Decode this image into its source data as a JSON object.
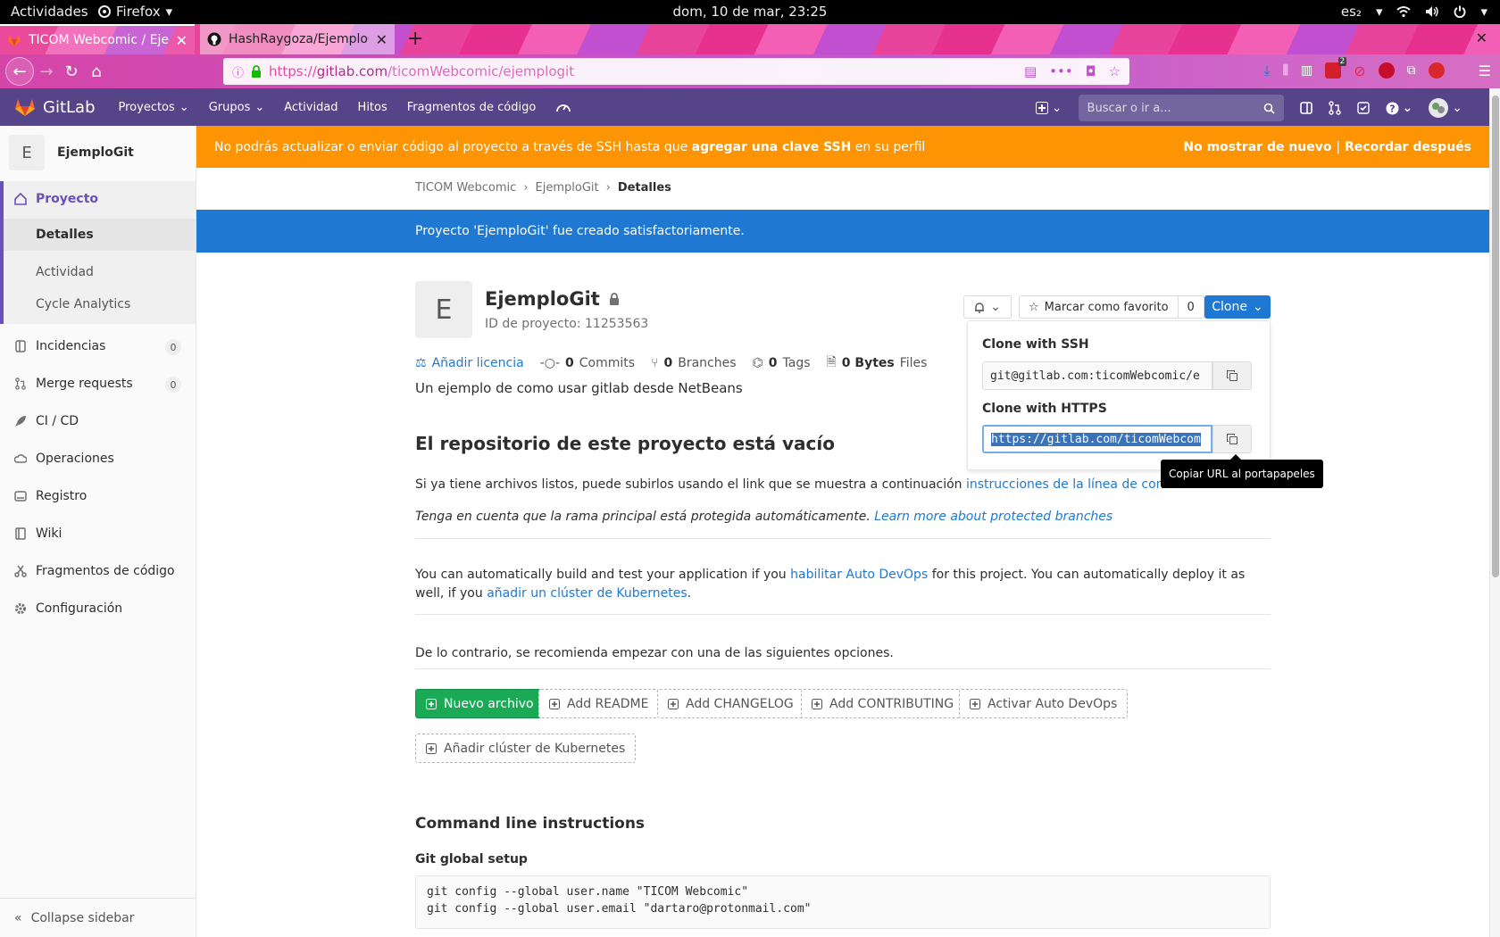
{
  "gnome": {
    "activities": "Actividades",
    "app": "Firefox",
    "clock": "dom, 10 de mar, 23:25",
    "keyboard": "es₂"
  },
  "browser": {
    "tabs": [
      {
        "title": "TICOM Webcomic / Ejem"
      },
      {
        "title": "HashRaygoza/EjemploGi"
      }
    ],
    "url": {
      "protocol": "https://",
      "domain": "gitlab.com",
      "path": "/ticomWebcomic/ejemplogit"
    },
    "notification_count": "2"
  },
  "gitlab": {
    "brand": "GitLab",
    "nav": [
      "Proyectos",
      "Grupos",
      "Actividad",
      "Hitos",
      "Fragmentos de código"
    ],
    "search_placeholder": "Buscar o ir a..."
  },
  "sidebar": {
    "project_letter": "E",
    "project_name": "EjemploGit",
    "group_label": "Proyecto",
    "sub_items": [
      "Detalles",
      "Actividad",
      "Cycle Analytics"
    ],
    "items": [
      {
        "label": "Incidencias",
        "count": "0",
        "icon": "issues-icon"
      },
      {
        "label": "Merge requests",
        "count": "0",
        "icon": "merge-request-icon"
      },
      {
        "label": "CI / CD",
        "icon": "rocket-icon"
      },
      {
        "label": "Operaciones",
        "icon": "cloud-gear-icon"
      },
      {
        "label": "Registro",
        "icon": "disk-icon"
      },
      {
        "label": "Wiki",
        "icon": "book-icon"
      },
      {
        "label": "Fragmentos de código",
        "icon": "scissors-icon"
      },
      {
        "label": "Configuración",
        "icon": "gear-icon"
      }
    ],
    "collapse": "Collapse sidebar"
  },
  "banner": {
    "text_before": "No podrás actualizar o enviar código al proyecto a través de SSH hasta que ",
    "link": "agregar una clave SSH",
    "text_after": " en su perfil",
    "dont_show": "No mostrar de nuevo",
    "separator": "|",
    "remind": "Recordar después"
  },
  "breadcrumb": [
    "TICOM Webcomic",
    "EjemploGit",
    "Detalles"
  ],
  "flash": "Proyecto 'EjemploGit' fue creado satisfactoriamente.",
  "project": {
    "letter": "E",
    "name": "EjemploGit",
    "id_text": "ID de proyecto: 11253563",
    "star_label": "Marcar como favorito",
    "star_count": "0",
    "clone_label": "Clone",
    "add_license": "Añadir licencia",
    "commits_n": "0",
    "commits": "Commits",
    "branches_n": "0",
    "branches": "Branches",
    "tags_n": "0",
    "tags": "Tags",
    "files_n": "0 Bytes",
    "files": "Files",
    "description": "Un ejemplo de como usar gitlab desde NetBeans"
  },
  "empty": {
    "title": "El repositorio de este proyecto está vacío",
    "p1_text": "Si ya tiene archivos listos, puede subirlos usando el link que se muestra a continuación ",
    "p1_link": "instrucciones de la línea de comando",
    "p1_end": ".",
    "p2_text": "Tenga en cuenta que la rama principal está protegida automáticamente. ",
    "p2_link": "Learn more about protected branches",
    "p3_a": "You can automatically build and test your application if you ",
    "p3_link1": "habilitar Auto DevOps",
    "p3_b": " for this project. You can automatically deploy it as well, if you ",
    "p3_link2": "añadir un clúster de Kubernetes",
    "p3_c": ".",
    "p4": "De lo contrario, se recomienda empezar con una de las siguientes opciones."
  },
  "buttons": {
    "new_file": "Nuevo archivo",
    "readme": "Add README",
    "changelog": "Add CHANGELOG",
    "contributing": "Add CONTRIBUTING",
    "autodevops": "Activar Auto DevOps",
    "k8s": "Añadir clúster de Kubernetes"
  },
  "cli": {
    "title": "Command line instructions",
    "setup_title": "Git global setup",
    "code": "git config --global user.name \"TICOM Webcomic\"\ngit config --global user.email \"dartaro@protonmail.com\""
  },
  "clone": {
    "ssh_label": "Clone with SSH",
    "ssh_value": "git@gitlab.com:ticomWebcomic/e",
    "https_label": "Clone with HTTPS",
    "https_value": "https://gitlab.com/ticomWebcom",
    "tooltip": "Copiar URL al portapapeles"
  },
  "colors": {
    "gitlab_header": "#554488",
    "warning": "#fc9403",
    "info": "#1f78d1",
    "success": "#1aaa55"
  }
}
